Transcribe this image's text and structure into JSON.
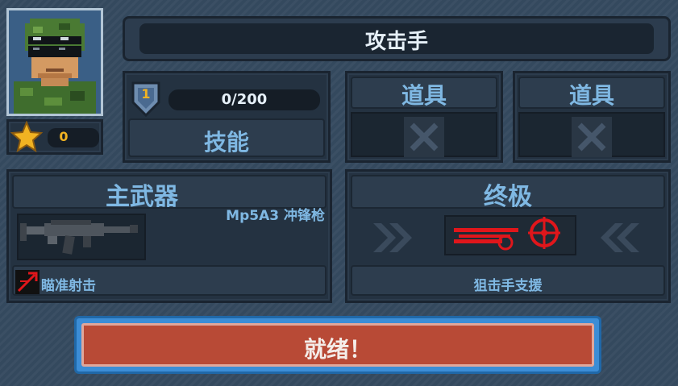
{
  "character": {
    "title": "攻击手",
    "stars": "0"
  },
  "skill": {
    "level": "1",
    "xp_text": "0/200",
    "xp_fraction": 0.0,
    "label": "技能"
  },
  "items": [
    {
      "label": "道具",
      "empty_icon": "x-icon"
    },
    {
      "label": "道具",
      "empty_icon": "x-icon"
    }
  ],
  "primary": {
    "header": "主武器",
    "weapon_name": "Mp5A3 冲锋枪",
    "perk": "瞄准射击"
  },
  "ultimate": {
    "header": "终极",
    "name": "狙击手支援"
  },
  "ready_button": {
    "label": "就绪！"
  },
  "colors": {
    "accent_text": "#7fb8e3",
    "ready_red": "#b84a36",
    "ultimate_red": "#e0161b",
    "star": "#f1b322"
  }
}
